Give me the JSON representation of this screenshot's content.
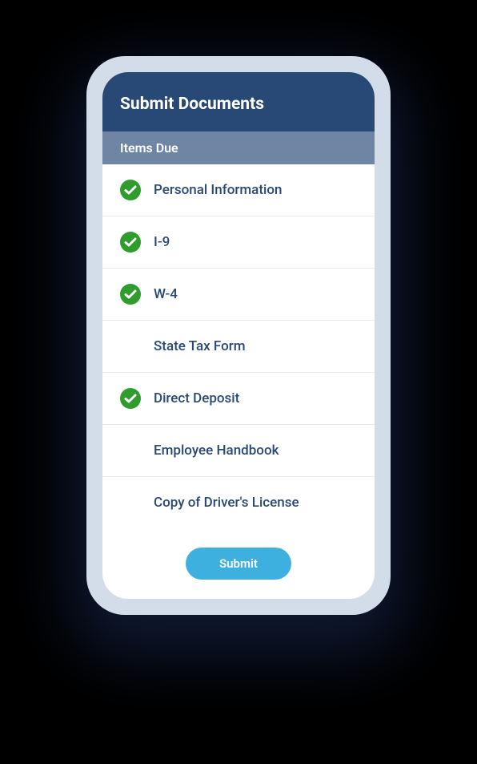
{
  "header": {
    "title": "Submit Documents"
  },
  "subheader": {
    "title": "Items Due"
  },
  "items": [
    {
      "label": "Personal Information",
      "completed": true
    },
    {
      "label": "I-9",
      "completed": true
    },
    {
      "label": "W-4",
      "completed": true
    },
    {
      "label": "State Tax Form",
      "completed": false
    },
    {
      "label": "Direct Deposit",
      "completed": true
    },
    {
      "label": "Employee Handbook",
      "completed": false
    },
    {
      "label": "Copy of Driver's License",
      "completed": false
    }
  ],
  "actions": {
    "submit_label": "Submit"
  },
  "colors": {
    "header_bg": "#284875",
    "subheader_bg": "#6e85a4",
    "check_green": "#2e9d2e",
    "submit_blue": "#3eb0e0",
    "text_primary": "#284875"
  }
}
